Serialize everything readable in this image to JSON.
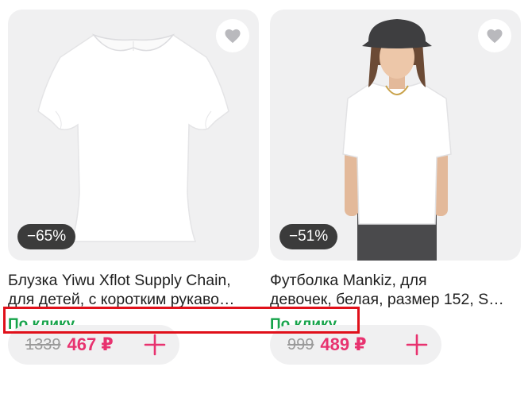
{
  "products": [
    {
      "discount": "−65%",
      "title_line1": "Блузка Yiwu Xflot Supply Chain,",
      "title_line2": "для детей, с коротким рукаво…",
      "promo": "По клику",
      "old_price": "1339",
      "new_price": "467 ₽"
    },
    {
      "discount": "−51%",
      "title_line1": "Футболка Mankiz, для",
      "title_line2": "девочек, белая, размер 152, S…",
      "promo": "По клику",
      "old_price": "999",
      "new_price": "489 ₽"
    }
  ],
  "colors": {
    "accent_price": "#e8326f",
    "promo_green": "#16a34a",
    "highlight": "#e0101a"
  }
}
